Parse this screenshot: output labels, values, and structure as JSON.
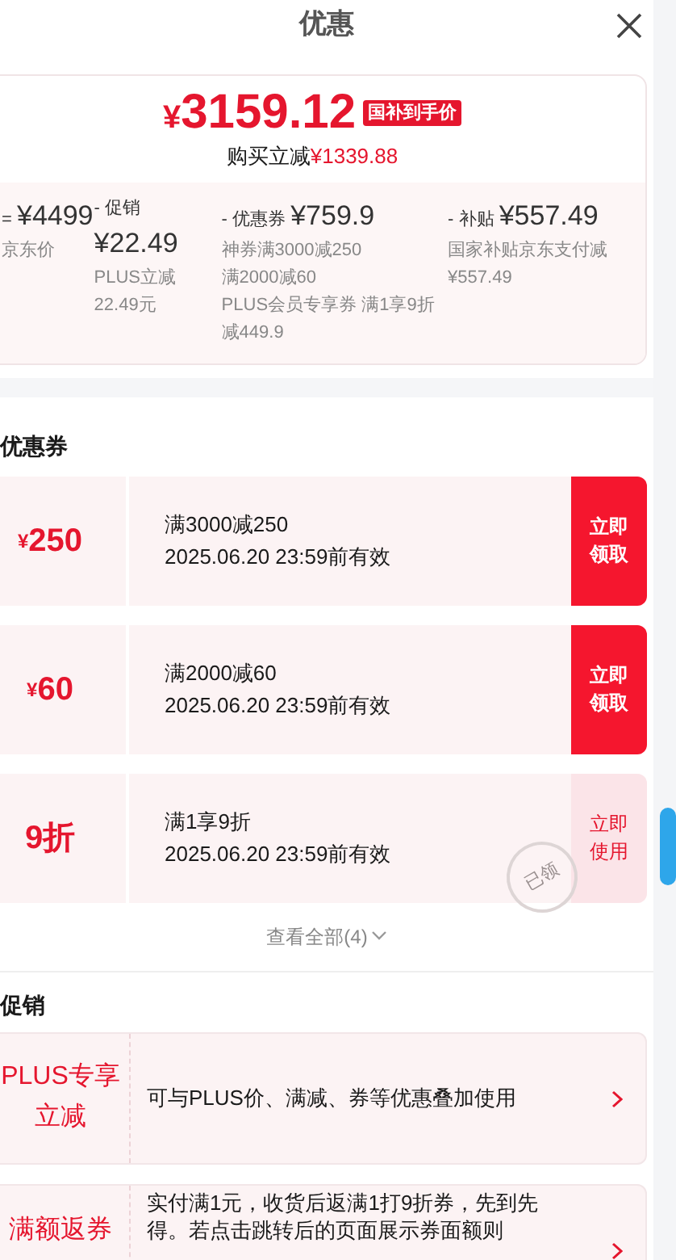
{
  "header": {
    "title": "优惠"
  },
  "price": {
    "currency": "¥",
    "amount": "3159.12",
    "tag": "国补到手价",
    "saving_label": "购买立减",
    "saving_amount": "¥1339.88"
  },
  "breakdown": [
    {
      "operator": "=",
      "amount": "¥4499",
      "notes": [
        "京东价"
      ]
    },
    {
      "operator": "-",
      "label": "促销",
      "amount": "¥22.49",
      "notes": [
        "PLUS立减",
        "22.49元"
      ]
    },
    {
      "operator": "-",
      "label": "优惠券",
      "amount": "¥759.9",
      "notes": [
        "神券满3000减250",
        "满2000减60",
        "PLUS会员专享券 满1享9折减449.9"
      ]
    },
    {
      "operator": "-",
      "label": "补贴",
      "amount": "¥557.49",
      "notes": [
        "国家补贴京东支付减¥557.49"
      ]
    }
  ],
  "coupon_section": {
    "title": "优惠券",
    "more": "查看全部(4)"
  },
  "coupons": [
    {
      "currency": "¥",
      "value": "250",
      "title": "满3000减250",
      "validity": "2025.06.20 23:59前有效",
      "button": "立即领取",
      "claimed": false
    },
    {
      "currency": "¥",
      "value": "60",
      "title": "满2000减60",
      "validity": "2025.06.20 23:59前有效",
      "button": "立即领取",
      "claimed": false
    },
    {
      "value": "9折",
      "title": "满1享9折",
      "validity": "2025.06.20 23:59前有效",
      "button": "立即使用",
      "claimed": true,
      "stamp": "已领"
    }
  ],
  "promo_section": {
    "title": "促销"
  },
  "promos": [
    {
      "label": "PLUS专享立减",
      "text": "可与PLUS价、满减、券等优惠叠加使用"
    },
    {
      "label": "满额返券",
      "text": "实付满1元，收货后返满1打9折券，先到先得。若点击跳转后的页面展示券面额则"
    }
  ]
}
